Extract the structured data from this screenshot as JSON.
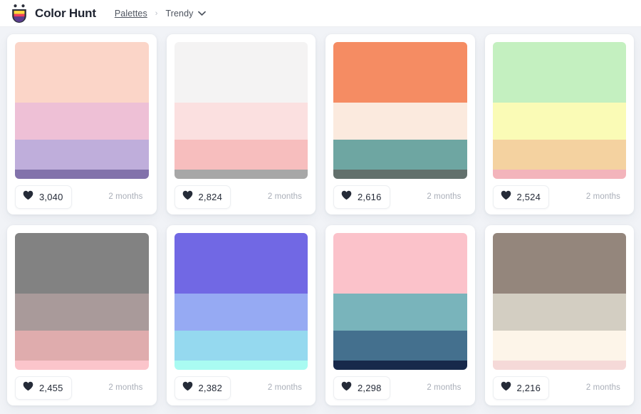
{
  "header": {
    "brand": "Color Hunt",
    "logo_icon": "colorhunt-logo-icon",
    "nav": {
      "parent": "Palettes",
      "separator": "›",
      "current": "Trendy",
      "chevron_icon": "chevron-down-icon"
    },
    "colors": {
      "bar_background": "#ffffff",
      "brand_text": "#1e2330",
      "nav_text": "#4e545f",
      "separator_text": "#b9bec7"
    }
  },
  "page": {
    "background": "#f1f3f7",
    "card_background": "#ffffff",
    "heart_icon": "heart-icon",
    "heart_color": "#252b38",
    "time_text_color": "#a9aeb8"
  },
  "palettes": [
    {
      "id": "palette-1",
      "colors": [
        "#fbd5c8",
        "#eec0d6",
        "#bfaedb",
        "#8272ab"
      ],
      "likes": "3,040",
      "time": "2 months"
    },
    {
      "id": "palette-2",
      "colors": [
        "#f4f3f3",
        "#fbe0e0",
        "#f7bebe",
        "#a7a7a7"
      ],
      "likes": "2,824",
      "time": "2 months"
    },
    {
      "id": "palette-3",
      "colors": [
        "#f58c63",
        "#fbeade",
        "#6ea6a2",
        "#62706c"
      ],
      "likes": "2,616",
      "time": "2 months"
    },
    {
      "id": "palette-4",
      "colors": [
        "#c4f0c0",
        "#fafbb6",
        "#f4d2a0",
        "#f3b4bb"
      ],
      "likes": "2,524",
      "time": "2 months"
    },
    {
      "id": "palette-5",
      "colors": [
        "#828282",
        "#a99a9a",
        "#dfacad",
        "#fbc5cb"
      ],
      "likes": "2,455",
      "time": "2 months"
    },
    {
      "id": "palette-6",
      "colors": [
        "#7168e4",
        "#96aaf3",
        "#95d9ef",
        "#a9fbf2"
      ],
      "likes": "2,382",
      "time": "2 months"
    },
    {
      "id": "palette-7",
      "colors": [
        "#fbc2ca",
        "#79b4bb",
        "#44708e",
        "#17294b"
      ],
      "likes": "2,298",
      "time": "2 months"
    },
    {
      "id": "palette-8",
      "colors": [
        "#94867c",
        "#d3cec2",
        "#fdf5e9",
        "#f5d9d8"
      ],
      "likes": "2,216",
      "time": "2 months"
    }
  ]
}
